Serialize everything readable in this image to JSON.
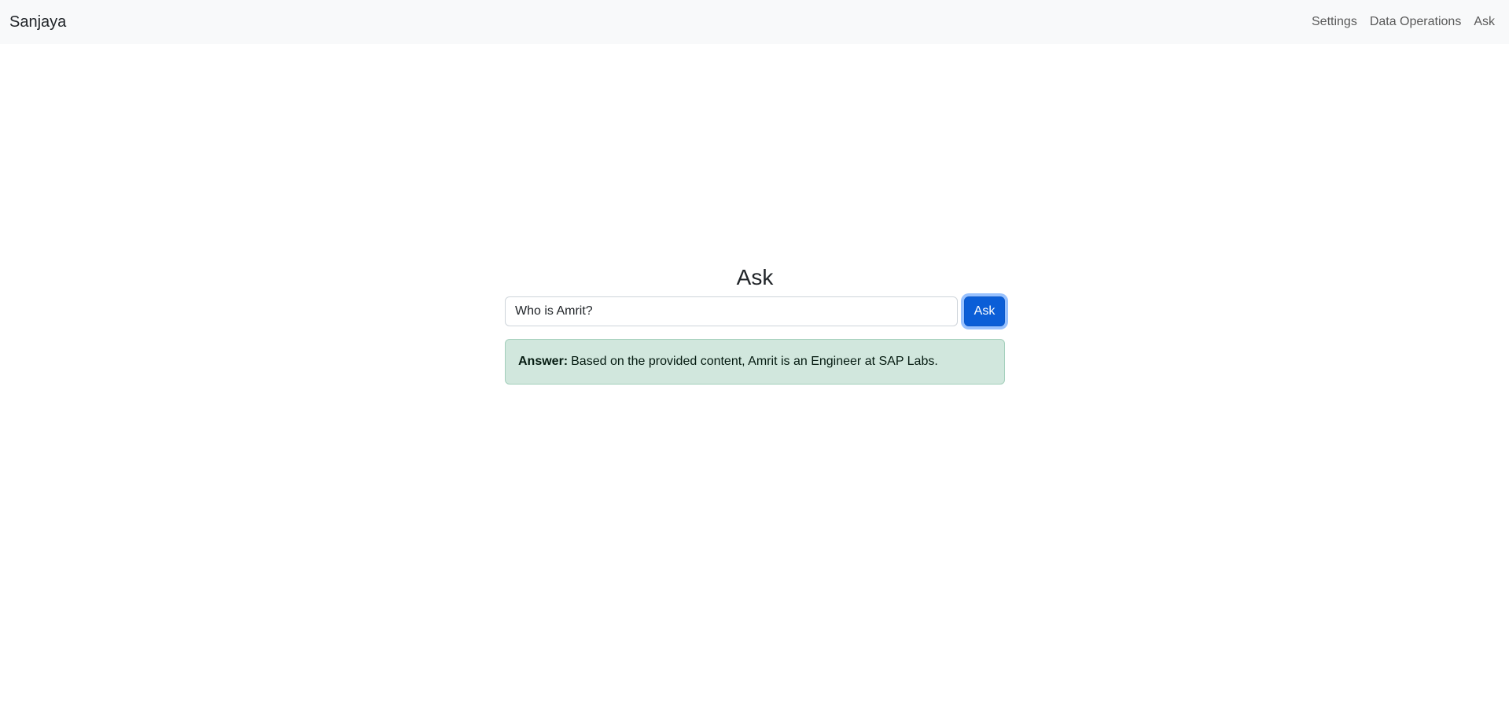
{
  "navbar": {
    "brand": "Sanjaya",
    "links": [
      {
        "label": "Settings"
      },
      {
        "label": "Data Operations"
      },
      {
        "label": "Ask"
      }
    ]
  },
  "ask": {
    "title": "Ask",
    "input_value": "Who is Amrit?",
    "button_label": "Ask",
    "answer_label": "Answer:",
    "answer_text": "Based on the provided content, Amrit is an Engineer at SAP Labs."
  },
  "colors": {
    "navbar_bg": "#f8f9fa",
    "primary_button": "#0b5ed7",
    "answer_bg": "#d1e7dd",
    "answer_border": "#a3cfbb"
  }
}
